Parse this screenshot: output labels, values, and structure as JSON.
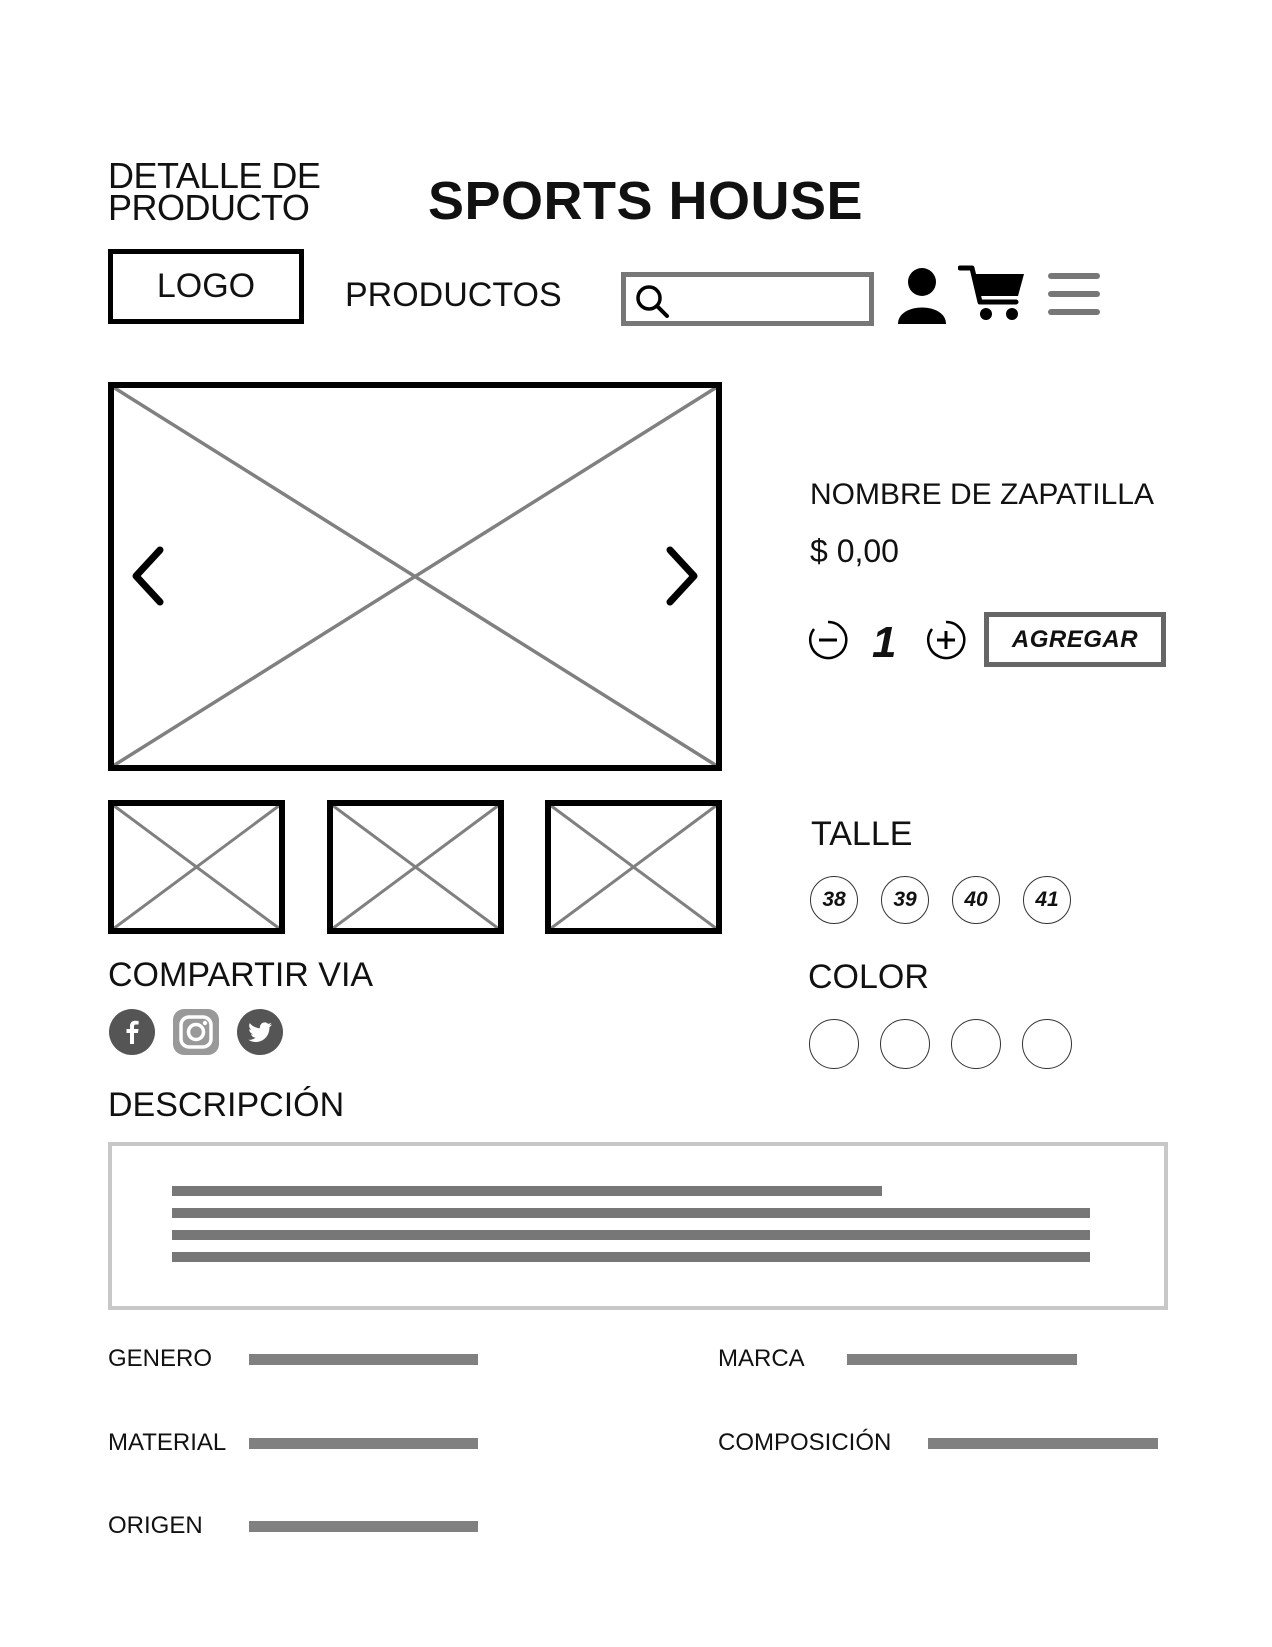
{
  "page_label": {
    "line1": "DETALLE DE",
    "line2": "PRODUCTO"
  },
  "header": {
    "brand": "SPORTS HOUSE",
    "logo": "LOGO",
    "nav_productos": "PRODUCTOS",
    "search": {
      "placeholder": "",
      "value": ""
    },
    "icons": [
      "search-icon",
      "user-icon",
      "cart-icon",
      "menu-icon"
    ]
  },
  "gallery": {
    "main_image": "image-placeholder",
    "prev_icon": "chevron-left-icon",
    "next_icon": "chevron-right-icon",
    "thumbnails": [
      "image-placeholder",
      "image-placeholder",
      "image-placeholder"
    ]
  },
  "product": {
    "name": "NOMBRE DE ZAPATILLA",
    "price": "$ 0,00",
    "quantity": "1",
    "add_button": "AGREGAR"
  },
  "talle": {
    "title": "TALLE",
    "sizes": [
      "38",
      "39",
      "40",
      "41"
    ]
  },
  "color": {
    "title": "COLOR",
    "swatches": [
      "#ffffff",
      "#ffffff",
      "#ffffff",
      "#ffffff"
    ]
  },
  "share": {
    "title": "COMPARTIR VIA",
    "icons": [
      "facebook-icon",
      "instagram-icon",
      "twitter-icon"
    ]
  },
  "descripcion": {
    "title": "DESCRIPCIÓN"
  },
  "attributes": {
    "genero": "GENERO",
    "material": "MATERIAL",
    "origen": "ORIGEN",
    "marca": "MARCA",
    "composicion": "COMPOSICIÓN"
  },
  "colors": {
    "border_dark": "#000000",
    "border_gray": "#777777",
    "placeholder_line": "#808080",
    "icon_dark": "#555555"
  }
}
